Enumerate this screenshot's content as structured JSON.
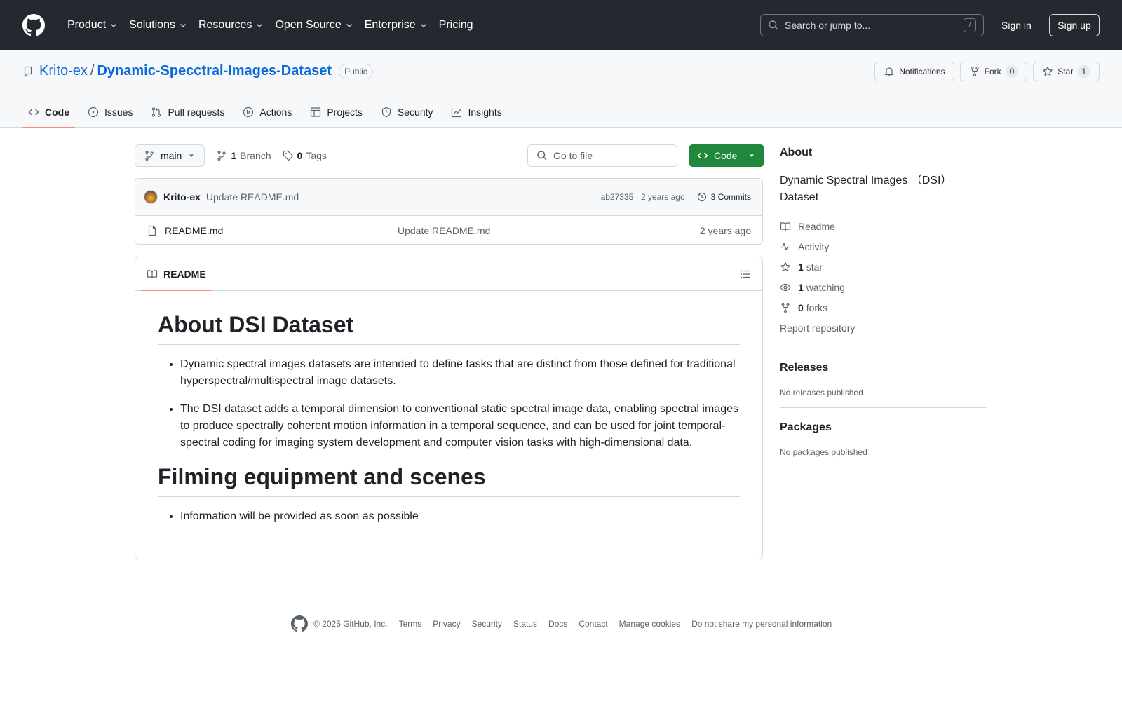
{
  "colors": {
    "header_bg": "#24292f",
    "link": "#0969da",
    "primary_button": "#1f883d",
    "active_tab_underline": "#fd8c73",
    "muted_text": "#59636e"
  },
  "header": {
    "nav": [
      {
        "label": "Product",
        "dropdown": true
      },
      {
        "label": "Solutions",
        "dropdown": true
      },
      {
        "label": "Resources",
        "dropdown": true
      },
      {
        "label": "Open Source",
        "dropdown": true
      },
      {
        "label": "Enterprise",
        "dropdown": true
      },
      {
        "label": "Pricing",
        "dropdown": false
      }
    ],
    "search_placeholder": "Search or jump to...",
    "search_shortcut": "/",
    "sign_in": "Sign in",
    "sign_up": "Sign up"
  },
  "repo": {
    "owner": "Krito-ex",
    "separator": "/",
    "name": "Dynamic-Specctral-Images-Dataset",
    "visibility": "Public",
    "notifications_label": "Notifications",
    "fork_label": "Fork",
    "fork_count": "0",
    "star_label": "Star",
    "star_count": "1"
  },
  "tabs": [
    {
      "label": "Code",
      "icon": "code-icon",
      "active": true
    },
    {
      "label": "Issues",
      "icon": "issue-icon",
      "active": false
    },
    {
      "label": "Pull requests",
      "icon": "pull-request-icon",
      "active": false
    },
    {
      "label": "Actions",
      "icon": "play-icon",
      "active": false
    },
    {
      "label": "Projects",
      "icon": "table-icon",
      "active": false
    },
    {
      "label": "Security",
      "icon": "shield-icon",
      "active": false
    },
    {
      "label": "Insights",
      "icon": "graph-icon",
      "active": false
    }
  ],
  "toolbar": {
    "branch": "main",
    "branch_count": "1",
    "branch_label": "Branch",
    "tag_count": "0",
    "tag_label": "Tags",
    "goto_placeholder": "Go to file",
    "code_button": "Code"
  },
  "latest_commit": {
    "author": "Krito-ex",
    "message": "Update README.md",
    "hash_time": "ab27335 · 2 years ago",
    "commits_label": "3 Commits"
  },
  "files": [
    {
      "name": "README.md",
      "message": "Update README.md",
      "date": "2 years ago",
      "icon": "file-icon"
    }
  ],
  "readme": {
    "tab_label": "README",
    "h1": "About DSI Dataset",
    "bullets1": [
      "Dynamic spectral images datasets are intended to define tasks that are distinct from those defined for traditional hyperspectral/multispectral image datasets.",
      "The DSI dataset adds a temporal dimension to conventional static spectral image data, enabling spectral images to produce spectrally coherent motion information in a temporal sequence, and can be used for joint temporal-spectral coding for imaging system development and computer vision tasks with high-dimensional data."
    ],
    "h2": "Filming equipment and scenes",
    "bullets2": [
      "Information will be provided as soon as possible"
    ]
  },
  "about": {
    "heading": "About",
    "description": "Dynamic Spectral Images （DSI） Dataset",
    "readme_label": "Readme",
    "activity_label": "Activity",
    "stars_count": "1",
    "stars_label": "star",
    "watching_count": "1",
    "watching_label": "watching",
    "forks_count": "0",
    "forks_label": "forks",
    "report_label": "Report repository"
  },
  "releases": {
    "heading": "Releases",
    "empty": "No releases published"
  },
  "packages": {
    "heading": "Packages",
    "empty": "No packages published"
  },
  "footer": {
    "copyright": "© 2025 GitHub, Inc.",
    "links": [
      "Terms",
      "Privacy",
      "Security",
      "Status",
      "Docs",
      "Contact",
      "Manage cookies",
      "Do not share my personal information"
    ]
  }
}
